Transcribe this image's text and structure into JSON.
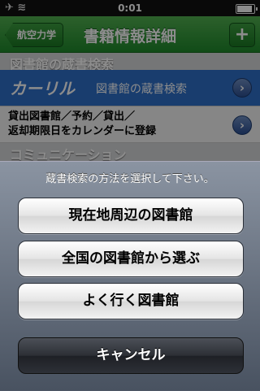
{
  "status_bar": {
    "time": "0:01"
  },
  "nav": {
    "back_label": "航空力学",
    "title": "書籍情報詳細",
    "add_label": "+"
  },
  "sections": {
    "library_header": "図書館の蔵書検索",
    "kariru_logo": "カーリル",
    "kariru_label": "図書館の蔵書検索",
    "calendar_line1": "貸出図書館／予約／貸出／",
    "calendar_line2": "返却期限日をカレンダーに登録",
    "communication_header": "コミュニケーション"
  },
  "action_sheet": {
    "title": "蔵書検索の方法を選択して下さい。",
    "buttons": [
      {
        "label": "現在地周辺の図書館"
      },
      {
        "label": "全国の図書館から選ぶ"
      },
      {
        "label": "よく行く図書館"
      }
    ],
    "cancel_label": "キャンセル"
  },
  "colors": {
    "nav_green": "#2e9a3a",
    "kariru_blue": "#2f6fc8",
    "accent_chevron": "#2c4f93"
  },
  "icons": {
    "airplane": "airplane-icon",
    "wifi": "wifi-icon",
    "battery": "battery-icon",
    "chevron": "chevron-right-icon"
  }
}
